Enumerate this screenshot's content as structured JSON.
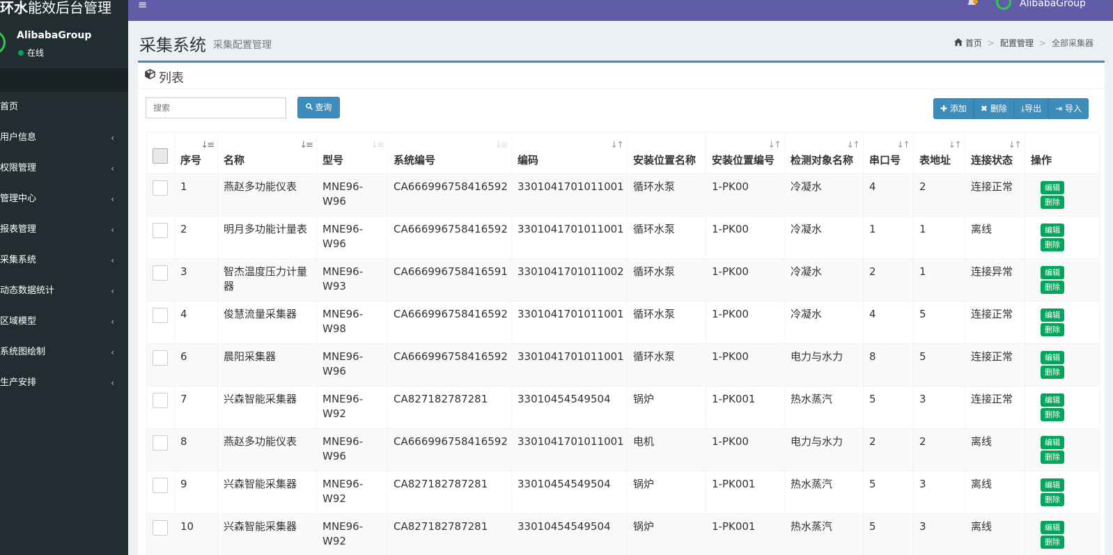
{
  "brand": {
    "bold": "环水",
    "rest": "能效后台管理"
  },
  "navbar": {
    "hamburger": "≡",
    "bell": "🔔",
    "user": "AlibabaGroup"
  },
  "sidebar": {
    "user_name": "AlibabaGroup",
    "status": "在线",
    "items": [
      {
        "label": "首页",
        "chevron": ""
      },
      {
        "label": "用户信息",
        "chevron": "‹"
      },
      {
        "label": "权限管理",
        "chevron": "‹"
      },
      {
        "label": "管理中心",
        "chevron": "‹"
      },
      {
        "label": "报表管理",
        "chevron": "‹"
      },
      {
        "label": "采集系统",
        "chevron": "‹"
      },
      {
        "label": "动态数据统计",
        "chevron": "‹"
      },
      {
        "label": "区域模型",
        "chevron": "‹"
      },
      {
        "label": "系统图绘制",
        "chevron": "‹"
      },
      {
        "label": "生产安排",
        "chevron": "‹"
      }
    ]
  },
  "header": {
    "title": "采集系统",
    "subtitle": "采集配置管理",
    "breadcrumb": {
      "home": "首页",
      "level1": "配置管理",
      "current": "全部采集器",
      "sep": ">"
    }
  },
  "box": {
    "title": "列表"
  },
  "toolbar": {
    "search_placeholder": "搜索",
    "query_label": "查询",
    "add_label": "添加",
    "delete_label": "删除",
    "export_label": "导出",
    "import_label": "导入"
  },
  "table": {
    "headers": {
      "index": "序号",
      "name": "名称",
      "model": "型号",
      "system_code": "系统编号",
      "code": "编码",
      "install_name": "安装位置名称",
      "install_code": "安装位置编号",
      "target": "检测对象名称",
      "port": "串口号",
      "address": "表地址",
      "status": "连接状态",
      "ops": "操作"
    },
    "edit_label": "编辑",
    "delete_label": "删除",
    "rows": [
      {
        "index": "1",
        "name": "燕赵多功能仪表",
        "model": "MNE96-W96",
        "system_code": "CA666996758416592",
        "code": "3301041701011001",
        "install_name": "循环水泵",
        "install_code": "1-PK00",
        "target": "冷凝水",
        "port": "4",
        "address": "2",
        "status": "连接正常"
      },
      {
        "index": "2",
        "name": "明月多功能计量表",
        "model": "MNE96-W96",
        "system_code": "CA666996758416592",
        "code": "3301041701011001",
        "install_name": "循环水泵",
        "install_code": "1-PK00",
        "target": "冷凝水",
        "port": "1",
        "address": "1",
        "status": "离线"
      },
      {
        "index": "3",
        "name": "智杰温度压力计量器",
        "model": "MNE96-W93",
        "system_code": "CA666996758416591",
        "code": "3301041701011002",
        "install_name": "循环水泵",
        "install_code": "1-PK00",
        "target": "冷凝水",
        "port": "2",
        "address": "1",
        "status": "连接异常"
      },
      {
        "index": "4",
        "name": "俊慧流量采集器",
        "model": "MNE96-W98",
        "system_code": "CA666996758416592",
        "code": "3301041701011001",
        "install_name": "循环水泵",
        "install_code": "1-PK00",
        "target": "冷凝水",
        "port": "4",
        "address": "5",
        "status": "连接正常"
      },
      {
        "index": "6",
        "name": "晨阳采集器",
        "model": "MNE96-W96",
        "system_code": "CA666996758416592",
        "code": "3301041701011001",
        "install_name": "循环水泵",
        "install_code": "1-PK00",
        "target": "电力与水力",
        "port": "8",
        "address": "5",
        "status": "连接正常"
      },
      {
        "index": "7",
        "name": "兴森智能采集器",
        "model": "MNE96-W92",
        "system_code": "CA827182787281",
        "code": "33010454549504",
        "install_name": "锅炉",
        "install_code": "1-PK001",
        "target": "热水蒸汽",
        "port": "5",
        "address": "3",
        "status": "连接正常"
      },
      {
        "index": "8",
        "name": "燕赵多功能仪表",
        "model": "MNE96-W96",
        "system_code": "CA666996758416592",
        "code": "3301041701011001",
        "install_name": "电机",
        "install_code": "1-PK00",
        "target": "电力与水力",
        "port": "2",
        "address": "2",
        "status": "离线"
      },
      {
        "index": "9",
        "name": "兴森智能采集器",
        "model": "MNE96-W92",
        "system_code": "CA827182787281",
        "code": "33010454549504",
        "install_name": "锅炉",
        "install_code": "1-PK001",
        "target": "热水蒸汽",
        "port": "5",
        "address": "3",
        "status": "离线"
      },
      {
        "index": "10",
        "name": "兴森智能采集器",
        "model": "MNE96-W92",
        "system_code": "CA827182787281",
        "code": "33010454549504",
        "install_name": "锅炉",
        "install_code": "1-PK001",
        "target": "热水蒸汽",
        "port": "5",
        "address": "3",
        "status": "离线"
      }
    ]
  }
}
